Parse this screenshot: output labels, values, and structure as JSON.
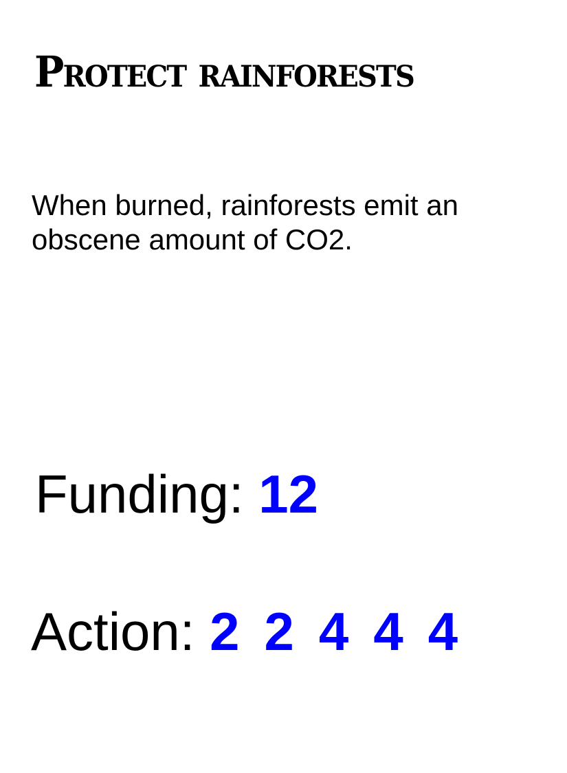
{
  "card": {
    "title": "Protect rainforests",
    "description": "When burned, rainforests emit an obscene amount of CO2.",
    "funding_label": "Funding:",
    "funding_value": "12",
    "action_label": "Action:",
    "action_values": [
      "2",
      "2",
      "4",
      "4",
      "4"
    ],
    "accent_color": "#0000ff"
  }
}
